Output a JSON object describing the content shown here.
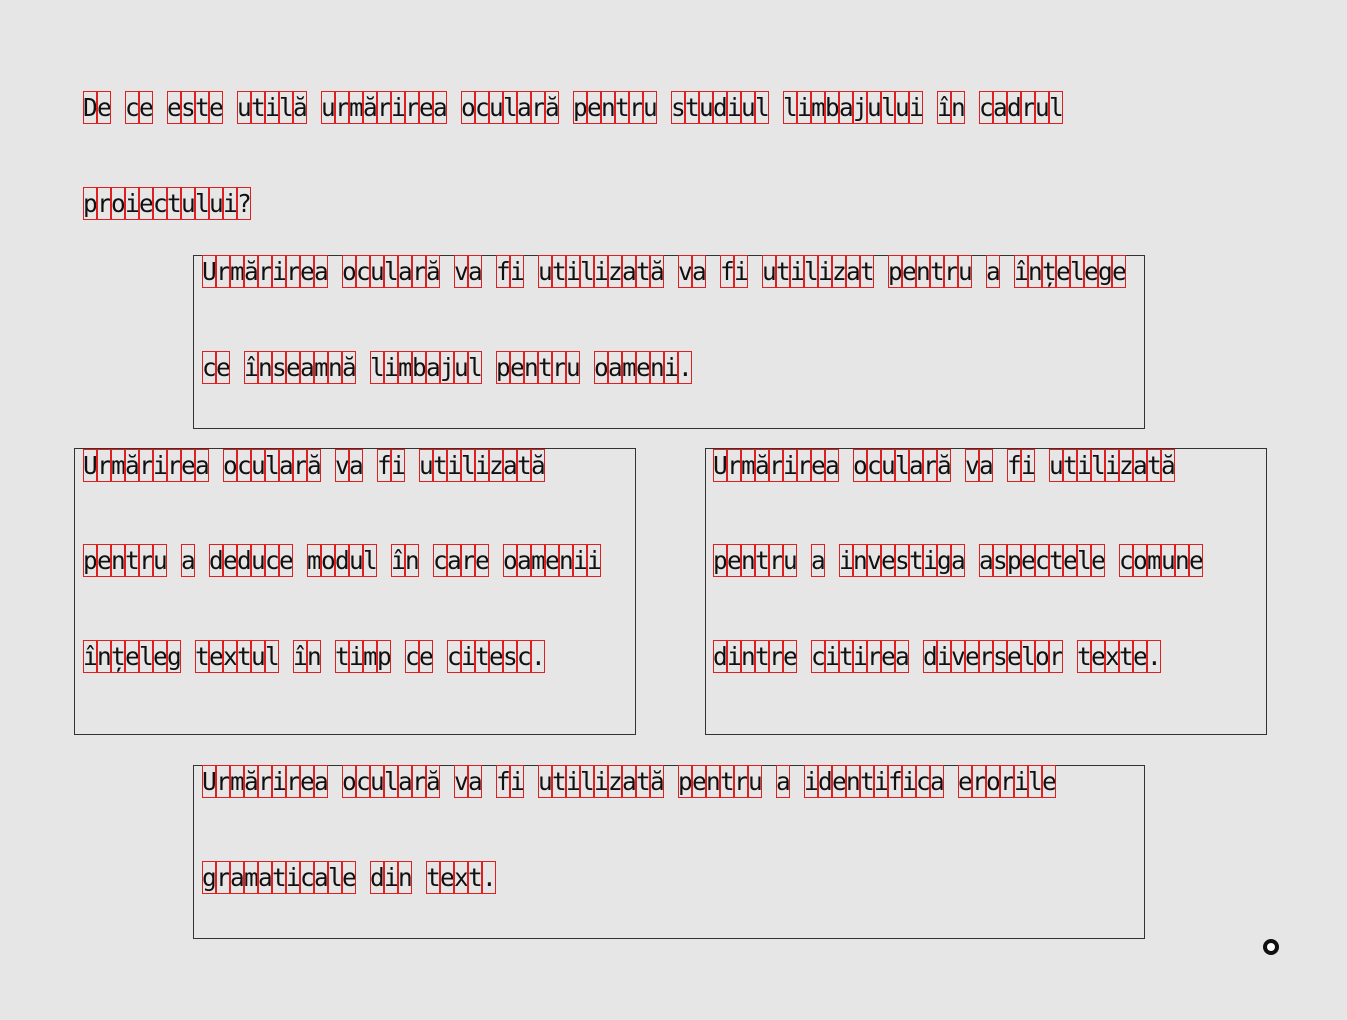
{
  "question": {
    "lines": [
      "De ce este utilă urmărirea oculară pentru studiul limbajului în cadrul",
      "proiectului?"
    ]
  },
  "options": [
    {
      "lines": [
        "Urmărirea oculară va fi utilizată va fi utilizat pentru a înțelege",
        "ce înseamnă limbajul pentru oameni."
      ]
    },
    {
      "lines": [
        "Urmărirea oculară va fi utilizată",
        "pentru a deduce modul în care oamenii",
        "înțeleg textul în timp ce citesc."
      ]
    },
    {
      "lines": [
        "Urmărirea oculară va fi utilizată",
        "pentru a investiga aspectele comune",
        "dintre citirea diverselor texte."
      ]
    },
    {
      "lines": [
        "Urmărirea oculară va fi utilizată pentru a identifica erorile",
        "gramaticale din text."
      ]
    }
  ],
  "colors": {
    "background": "#e6e6e6",
    "char_outline": "#e02020",
    "box_border": "#333333"
  },
  "icons": {
    "cursor": "gaze-cursor-icon"
  }
}
